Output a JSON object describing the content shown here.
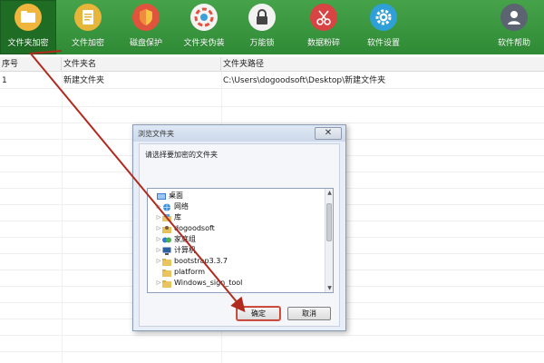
{
  "toolbar": {
    "items": [
      {
        "label": "文件夹加密",
        "icon": "folder-icon"
      },
      {
        "label": "文件加密",
        "icon": "document-icon"
      },
      {
        "label": "磁盘保护",
        "icon": "shield-icon"
      },
      {
        "label": "文件夹伪装",
        "icon": "disguise-icon"
      },
      {
        "label": "万能锁",
        "icon": "lock-icon"
      },
      {
        "label": "数据粉碎",
        "icon": "scissors-icon"
      },
      {
        "label": "软件设置",
        "icon": "gear-icon"
      },
      {
        "label": "软件帮助",
        "icon": "user-icon"
      }
    ],
    "active_index": 0
  },
  "table": {
    "columns": [
      "序号",
      "文件夹名",
      "文件夹路径"
    ],
    "rows": [
      {
        "index": "1",
        "name": "新建文件夹",
        "path": "C:\\Users\\dogoodsoft\\Desktop\\新建文件夹"
      }
    ]
  },
  "dialog": {
    "title": "浏览文件夹",
    "close_label": "✕",
    "prompt": "请选择要加密的文件夹",
    "tree": [
      {
        "label": "桌面",
        "icon": "desktop-icon",
        "arrow": ""
      },
      {
        "label": "网络",
        "icon": "network-icon",
        "arrow": "▷"
      },
      {
        "label": "库",
        "icon": "library-icon",
        "arrow": "▷"
      },
      {
        "label": "dogoodsoft",
        "icon": "user-folder-icon",
        "arrow": "▷"
      },
      {
        "label": "家庭组",
        "icon": "homegroup-icon",
        "arrow": "▷"
      },
      {
        "label": "计算机",
        "icon": "computer-icon",
        "arrow": "▷"
      },
      {
        "label": "bootstrap3.3.7",
        "icon": "folder-icon",
        "arrow": "▷"
      },
      {
        "label": "platform",
        "icon": "folder-icon",
        "arrow": ""
      },
      {
        "label": "Windows_sign_tool",
        "icon": "folder-icon",
        "arrow": "▷"
      }
    ],
    "ok_label": "确定",
    "cancel_label": "取消"
  },
  "colors": {
    "toolbar_green": "#3a9a3f",
    "active_green": "#1f6d24",
    "annotation_red": "#b22a1e"
  }
}
